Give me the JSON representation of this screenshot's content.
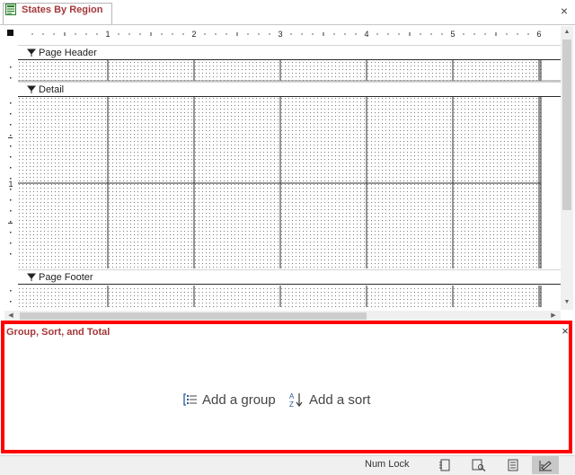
{
  "document": {
    "tab_title": "States By Region",
    "close_glyph": "×",
    "tab_icon": "report-icon"
  },
  "ruler": {
    "inch_labels": [
      "1",
      "2",
      "3",
      "4",
      "5",
      "6"
    ],
    "vertical_labels": [
      "1"
    ]
  },
  "sections": {
    "page_header": "Page Header",
    "detail": "Detail",
    "page_footer": "Page Footer"
  },
  "gst_pane": {
    "title": "Group, Sort, and Total",
    "close_glyph": "×",
    "add_group_label": "Add a group",
    "add_sort_label": "Add a sort",
    "highlight_color": "#ff0000"
  },
  "statusbar": {
    "num_lock": "Num Lock",
    "views": [
      "report-view-icon",
      "print-preview-icon",
      "layout-view-icon",
      "design-view-icon"
    ],
    "active_view": "design-view-icon"
  },
  "colors": {
    "accent": "#a4373a",
    "grid_line": "#2b2b2b",
    "dot": "#7a7a7a"
  }
}
